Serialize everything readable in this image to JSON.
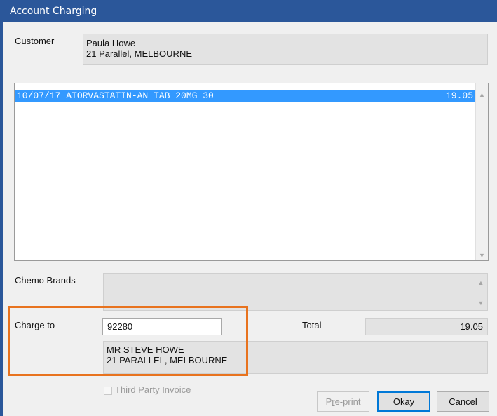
{
  "window": {
    "title": "Account Charging"
  },
  "customer": {
    "label": "Customer",
    "name": "Paula Howe",
    "address": "21 Parallel, MELBOURNE"
  },
  "transactions": {
    "rows": [
      {
        "description": "10/07/17 ATORVASTATIN-AN TAB 20MG 30",
        "amount": "19.05",
        "selected": true
      }
    ]
  },
  "chemo_brands": {
    "label": "Chemo Brands"
  },
  "charge_to": {
    "label": "Charge to",
    "account_value": "92280",
    "name": "MR STEVE HOWE",
    "address": "21 PARALLEL, MELBOURNE"
  },
  "total": {
    "label": "Total",
    "value": "19.05"
  },
  "third_party_invoice": {
    "label_first": "T",
    "label_rest": "hird Party Invoice",
    "checked": false,
    "enabled": false
  },
  "buttons": {
    "preprint_first": "P",
    "preprint_underlined": "r",
    "preprint_rest": "e-print",
    "okay": "Okay",
    "cancel": "Cancel"
  },
  "colors": {
    "title_bar": "#2b579a",
    "selection": "#3399ff",
    "highlight": "#e8731f"
  }
}
